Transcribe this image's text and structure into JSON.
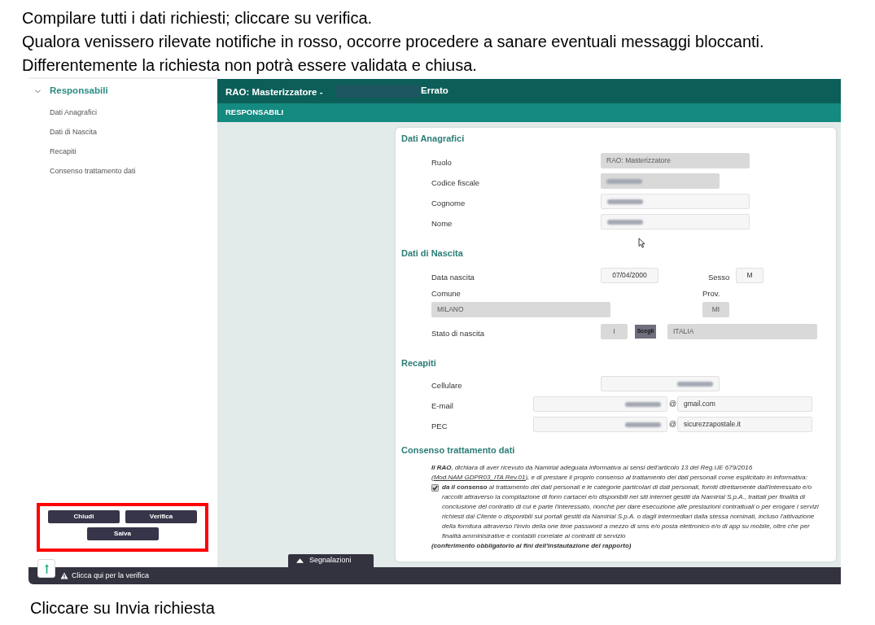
{
  "instructions": [
    "Compilare tutti i dati richiesti; cliccare su verifica.",
    "Qualora venissero rilevate notifiche in rosso, occorre procedere a sanare eventuali messaggi bloccanti.",
    "Differentemente la richiesta non potrà essere validata e chiusa."
  ],
  "app": {
    "sidebar": {
      "section": {
        "label": "Responsabili",
        "expanded": true
      },
      "items": [
        {
          "label": "Dati Anagrafici"
        },
        {
          "label": "Dati di Nascita"
        },
        {
          "label": "Recapiti"
        },
        {
          "label": "Consenso trattamento dati"
        }
      ],
      "buttons": [
        {
          "label": "Chiudi"
        },
        {
          "label": "Verifica"
        },
        {
          "label": "Salva"
        }
      ]
    },
    "header": {
      "title": "RAO: Masterizzatore -",
      "redacted": true,
      "status": "Errato",
      "subtitle": "RESPONSABILI"
    },
    "sections": [
      {
        "kind": "identity",
        "title": "Dati Anagrafici",
        "fields": [
          {
            "label": "Ruolo",
            "value": "RAO: Masterizzatore",
            "disabled": true
          },
          {
            "label": "Codice fiscale",
            "disabled": true,
            "blurred": true
          },
          {
            "label": "Cognome",
            "disabled": false,
            "blurred": true
          },
          {
            "label": "Nome",
            "disabled": false,
            "blurred": true
          }
        ]
      },
      {
        "kind": "birth",
        "title": "Dati di Nascita",
        "fields": [
          {
            "label": "Data nascita",
            "value": "07/04/2000",
            "disabled": false
          },
          {
            "label": "Sesso",
            "value": "M",
            "disabled": false
          },
          {
            "label": "Comune",
            "value": "MILANO",
            "disabled": true
          },
          {
            "label": "Prov.",
            "value": "MI",
            "disabled": true
          },
          {
            "label": "Stato di nascita",
            "code": "I",
            "button": "Scegli",
            "value": "ITALIA",
            "disabled": true
          }
        ]
      },
      {
        "kind": "contacts",
        "title": "Recapiti",
        "fields": [
          {
            "kind": "phone",
            "label": "Cellulare",
            "blurred": true,
            "disabled": false
          },
          {
            "kind": "email",
            "label": "E-mail",
            "blurred": true,
            "separator": "@",
            "domain": "gmail.com",
            "disabled": false
          },
          {
            "kind": "email",
            "label": "PEC",
            "blurred": true,
            "separator": "@",
            "domain": "sicurezzapostale.it",
            "disabled": false
          }
        ]
      },
      {
        "kind": "consent",
        "title": "Consenso trattamento dati",
        "intro": "**Il RAO**, dichiara di aver ricevuto da Namirial adeguata informativa ai sensi dell'articolo 13 del Reg.UE 679/2016 (",
        "link": "Mod.NAM GDPR03_ITA Rev.01",
        "intro_end": "), e di prestare il proprio consenso al trattamento dei dati personali come esplicitato in informativa:",
        "checked": true,
        "statement": "**da il consenso** al trattamento dei dati personali e le categorie particolari di dati personali, forniti direttamente dall'interessato e/o raccolti attraverso la compilazione di form cartacei e/o disponibili nei siti internet gestiti da Namirial S.p.A., trattati per finalità di conclusione del contratto di cui è parte l'interessato, nonché per dare esecuzione alle prestazioni contrattuali o per erogare i servizi richiesti dal Cliente o disponibili sui portali gestiti da Namirial S.p.A. o dagli intermediari dalla stessa nominati, incluso l'attivazione della fornitura attraverso l'invio della one time password a mezzo di sms e/o posta elettronico e/o di app su mobile, oltre che per finalità amministrative e contabili correlate ai contratti di servizio",
        "note": "(conferimento obbligatorio ai fini dell'instautazione del rapporto)"
      }
    ],
    "footer": {
      "tab": "Segnalazioni",
      "status": "Clicca qui per la verifica"
    }
  },
  "closing": "Cliccare su Invia richiesta"
}
